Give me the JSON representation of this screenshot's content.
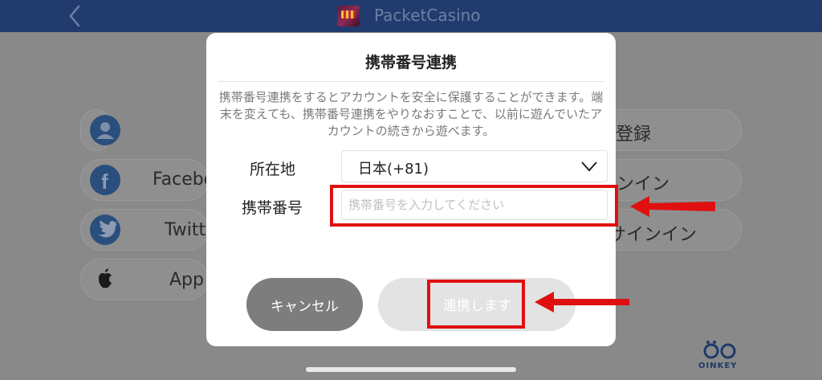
{
  "header": {
    "title": "PacketCasino"
  },
  "background_list": {
    "rows": [
      {
        "left_text": "",
        "right_text": "登録"
      },
      {
        "left_text": "Facebo",
        "right_text": "ンイン"
      },
      {
        "left_text": "Twitt",
        "right_text": "サインイン"
      },
      {
        "left_text": "App",
        "right_text": ""
      }
    ]
  },
  "dialog": {
    "title": "携帯番号連携",
    "description": "携帯番号連携をするとアカウントを安全に保護することができます。端末を変えても、携帯番号連携をやりなおすことで、以前に遊んでいたアカウントの続きから遊べます。",
    "region_label": "所在地",
    "region_value": "日本(+81)",
    "phone_label": "携帯番号",
    "phone_placeholder": "携帯番号を入力してください",
    "phone_value": "",
    "cancel_label": "キャンセル",
    "link_label": "連携します"
  },
  "watermark": {
    "text": "OINKEY"
  },
  "colors": {
    "header_bg": "#223b6e",
    "overlay": "#898989",
    "highlight": "#e01010",
    "cancel_bg": "#7d7d7d",
    "link_bg_disabled": "#e3e3e3"
  },
  "icons": [
    "chevron-left-icon",
    "app-logo",
    "user-icon",
    "facebook-icon",
    "twitter-icon",
    "apple-icon",
    "chevron-down-icon",
    "arrow-left-icon",
    "oinkey-logo"
  ]
}
